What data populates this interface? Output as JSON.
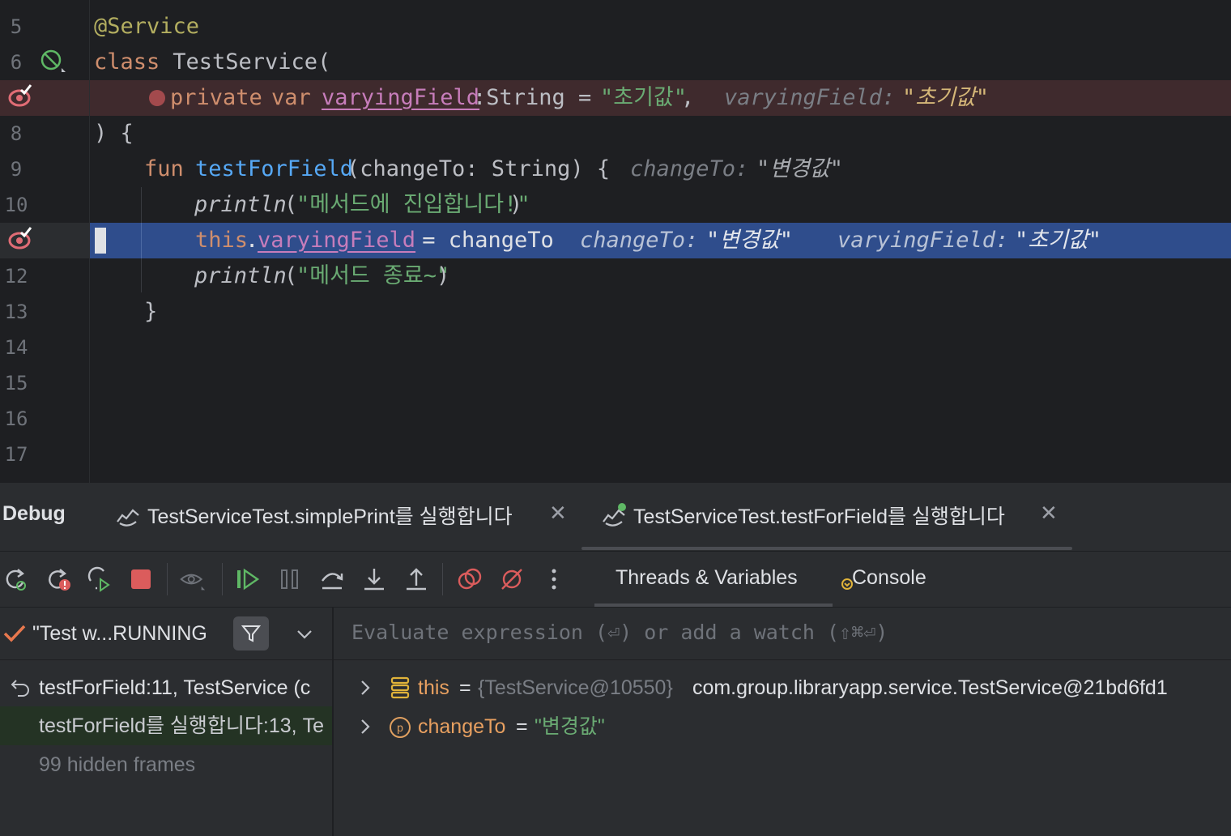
{
  "editor": {
    "line_numbers": [
      "5",
      "6",
      "",
      "8",
      "9",
      "10",
      "",
      "12",
      "13",
      "14",
      "15",
      "16",
      "17"
    ],
    "lines": {
      "l5": {
        "ann": "@Service"
      },
      "l6": {
        "kw": "class",
        "name": " TestService("
      },
      "l7": {
        "kw1": "private",
        "kw2": "var",
        "prop": "varyingField",
        "type": ":String = ",
        "str": "\"초기값\"",
        "comma": ",",
        "hint_label": "varyingField:",
        "hint_value": "\"초기값\""
      },
      "l8": {
        "text": ") {"
      },
      "l9": {
        "kw": "fun",
        "fn": "testForField",
        "params": "(changeTo: String) {",
        "hint_label": "changeTo:",
        "hint_value": "\"변경값\""
      },
      "l10": {
        "fn": "println",
        "open": "(",
        "str": "\"메서드에 진입합니다!\"",
        "close": ")"
      },
      "l11": {
        "kw": "this",
        "dot": ".",
        "prop": "varyingField",
        "rest": " = changeTo",
        "hint1_label": "changeTo:",
        "hint1_value": "\"변경값\"",
        "hint2_label": "varyingField:",
        "hint2_value": "\"초기값\""
      },
      "l12": {
        "fn": "println",
        "open": "(",
        "str": "\"메서드 종료~\"",
        "close": ")"
      },
      "l13": {
        "text": "}"
      }
    }
  },
  "debug": {
    "title": "Debug",
    "tabs": [
      {
        "label": "TestServiceTest.simplePrint를 실행합니다"
      },
      {
        "label": "TestServiceTest.testForField를 실행합니다"
      }
    ],
    "view_tabs": [
      "Threads & Variables",
      "Console"
    ]
  },
  "threads": {
    "selected_thread": "\"Test w...RUNNING",
    "frames": [
      {
        "label": "testForField:11, TestService (c"
      },
      {
        "label": "testForField를 실행합니다:13, Te"
      },
      {
        "label": "99 hidden frames"
      }
    ]
  },
  "variables": {
    "eval_placeholder": "Evaluate expression (⏎) or add a watch (⇧⌘⏎)",
    "items": [
      {
        "name": "this",
        "eq": " = ",
        "type": "{TestService@10550}",
        "value": " com.group.libraryapp.service.TestService@21bd6fd1"
      },
      {
        "name": "changeTo",
        "eq": " = ",
        "value": "\"변경값\""
      }
    ]
  },
  "colors": {
    "breakpoint_line": "#3f2a2d",
    "execution_line": "#2f4d8c",
    "keyword": "#cf8e6d",
    "string": "#6aab73",
    "function": "#56a8f5",
    "property": "#c77dbb",
    "breakpoint": "#db5c5c"
  }
}
